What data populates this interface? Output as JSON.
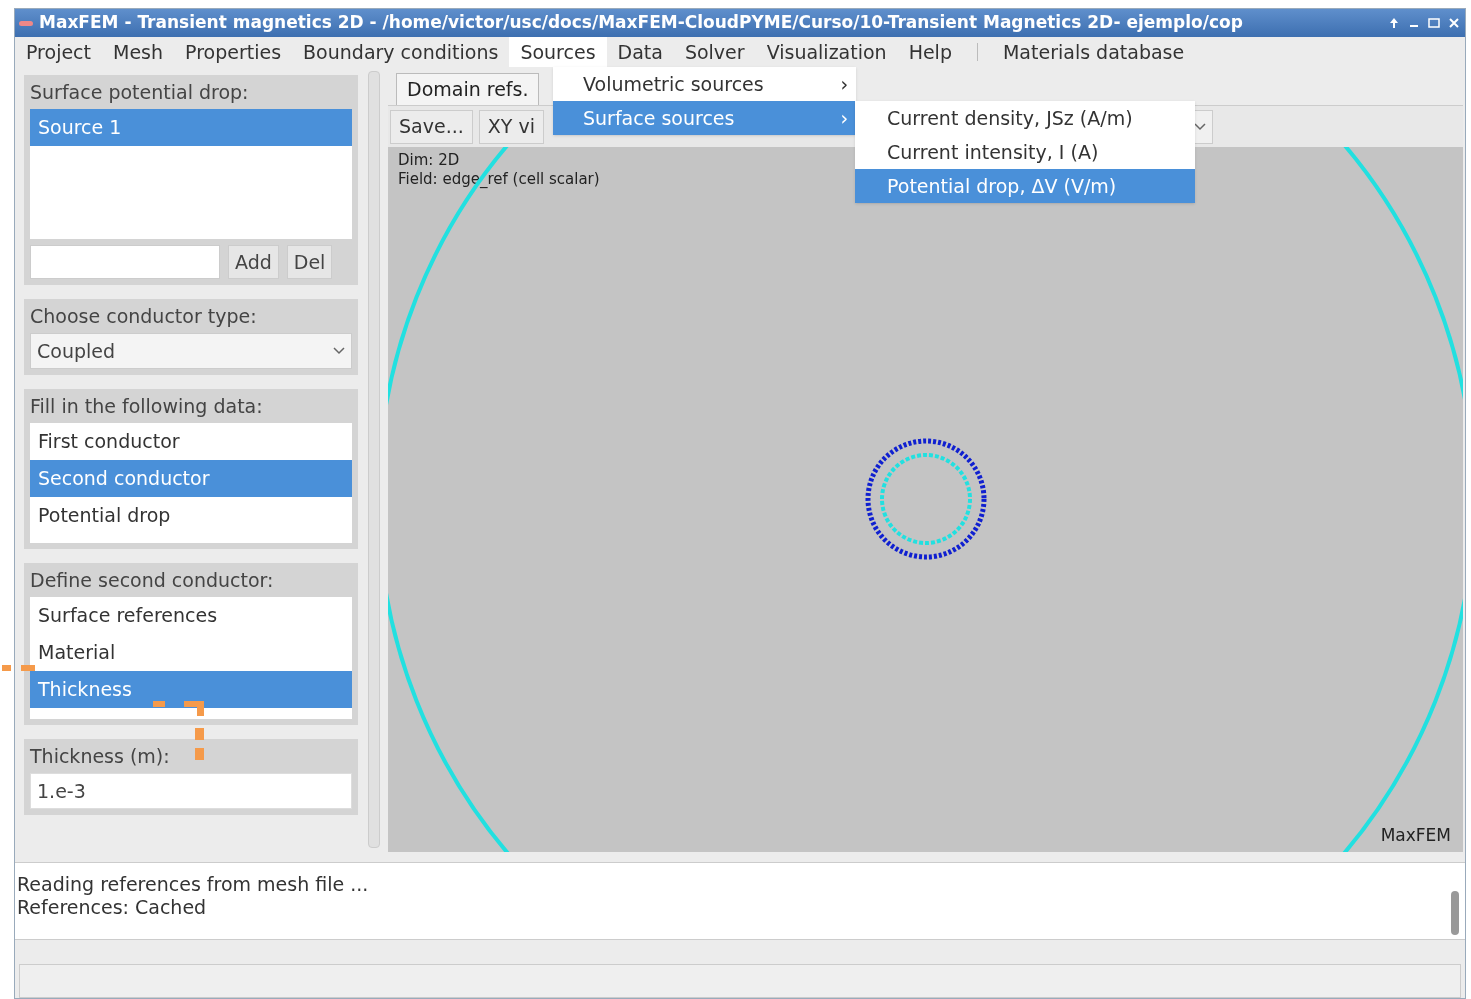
{
  "window": {
    "title": "MaxFEM - Transient magnetics 2D - /home/victor/usc/docs/MaxFEM-CloudPYME/Curso/10-Transient Magnetics 2D- ejemplo/cop"
  },
  "menu_bar": [
    {
      "label": "Project",
      "selected": false
    },
    {
      "label": "Mesh",
      "selected": false
    },
    {
      "label": "Properties",
      "selected": false
    },
    {
      "label": "Boundary conditions",
      "selected": false
    },
    {
      "label": "Sources",
      "selected": true
    },
    {
      "label": "Data",
      "selected": false
    },
    {
      "label": "Solver",
      "selected": false
    },
    {
      "label": "Visualization",
      "selected": false
    },
    {
      "label": "Help",
      "selected": false
    },
    {
      "label": "Materials database",
      "selected": false
    }
  ],
  "sources_menu": [
    {
      "label": "Volumetric sources",
      "arrow": "›",
      "selected": false
    },
    {
      "label": "Surface sources",
      "arrow": "›",
      "selected": true
    }
  ],
  "surface_sources_menu": [
    {
      "label": "Current density, JSz (A/m)",
      "selected": false
    },
    {
      "label": "Current intensity, I (A)",
      "selected": false
    },
    {
      "label": "Potential drop, ΔV (V/m)",
      "selected": true
    }
  ],
  "left_panel": {
    "sources": {
      "title": "Surface potential drop:",
      "items": [
        {
          "label": "Source 1",
          "selected": true
        }
      ],
      "buttons": [
        "Add",
        "Del"
      ]
    },
    "conductor_type": {
      "title": "Choose conductor type:",
      "value": "Coupled"
    },
    "fill_data": {
      "title": "Fill in the following data:",
      "items": [
        {
          "label": "First conductor",
          "selected": false
        },
        {
          "label": "Second conductor",
          "selected": true
        },
        {
          "label": "Potential drop",
          "selected": false
        }
      ]
    },
    "define": {
      "title": "Define second conductor:",
      "items": [
        {
          "label": "Surface references",
          "selected": false
        },
        {
          "label": "Material",
          "selected": false
        },
        {
          "label": "Thickness",
          "selected": true
        }
      ]
    },
    "thickness": {
      "title": "Thickness (m):",
      "value": "1.e-3"
    }
  },
  "viewer": {
    "tab": "Domain refs.",
    "buttons": [
      "Save...",
      "XY vi"
    ],
    "info": [
      "Dim: 2D",
      "Field: edge_ref (cell scalar)"
    ],
    "watermark": "MaxFEM"
  },
  "log": [
    "Reading references from mesh file ...",
    "References: Cached"
  ]
}
